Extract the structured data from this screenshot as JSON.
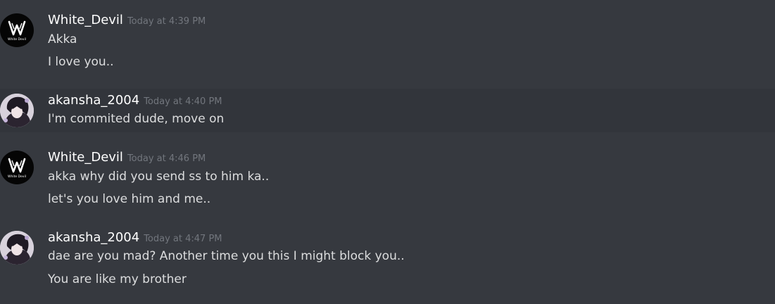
{
  "messages": [
    {
      "author": "White_Devil",
      "timestamp": "Today at 4:39 PM",
      "lines": [
        "Akka",
        "I love you.."
      ],
      "avatar_icon": "white-devil-logo-icon"
    },
    {
      "author": "akansha_2004",
      "timestamp": "Today at 4:40 PM",
      "lines": [
        "I'm commited dude, move on"
      ],
      "avatar_icon": "anime-avatar-icon"
    },
    {
      "author": "White_Devil",
      "timestamp": "Today at 4:46 PM",
      "lines": [
        "akka why did you send ss to him ka..",
        "let's you love him and me.."
      ],
      "avatar_icon": "white-devil-logo-icon"
    },
    {
      "author": "akansha_2004",
      "timestamp": "Today at 4:47 PM",
      "lines": [
        "dae are you mad? Another time you this I might block you..",
        "You are like my brother"
      ],
      "avatar_icon": "anime-avatar-icon"
    }
  ],
  "avatar_logo_text": "White Devil",
  "colors": {
    "background": "#36393f",
    "hover_background": "#32353b",
    "username": "#ffffff",
    "timestamp": "#72767d",
    "message_text": "#dcddde"
  }
}
